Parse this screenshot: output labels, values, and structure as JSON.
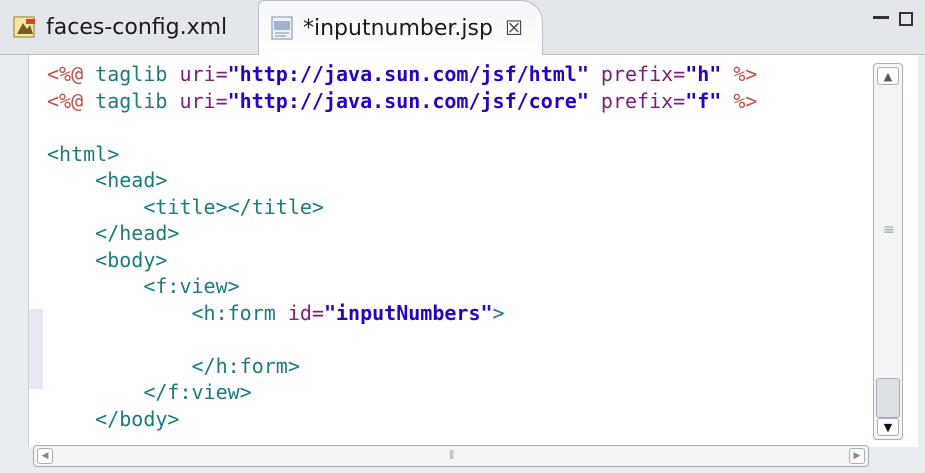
{
  "tabs": [
    {
      "label": "faces-config.xml",
      "icon": "xml-file-icon",
      "active": false
    },
    {
      "label": "*inputnumber.jsp",
      "icon": "jsp-file-icon",
      "active": true,
      "close": "☒"
    }
  ],
  "window_controls": {
    "minimize": "minimize-icon",
    "maximize": "maximize-icon"
  },
  "code_lines": [
    [
      {
        "t": "<%@",
        "c": "pct"
      },
      {
        "t": " taglib ",
        "c": "tagn"
      },
      {
        "t": "uri=",
        "c": "attr"
      },
      {
        "t": "\"http://java.sun.com/jsf/html\"",
        "c": "str"
      },
      {
        "t": " ",
        "c": "plain"
      },
      {
        "t": "prefix=",
        "c": "attr"
      },
      {
        "t": "\"h\"",
        "c": "str"
      },
      {
        "t": " %>",
        "c": "pct"
      }
    ],
    [
      {
        "t": "<%@",
        "c": "pct"
      },
      {
        "t": " taglib ",
        "c": "tagn"
      },
      {
        "t": "uri=",
        "c": "attr"
      },
      {
        "t": "\"http://java.sun.com/jsf/core\"",
        "c": "str"
      },
      {
        "t": " ",
        "c": "plain"
      },
      {
        "t": "prefix=",
        "c": "attr"
      },
      {
        "t": "\"f\"",
        "c": "str"
      },
      {
        "t": " %>",
        "c": "pct"
      }
    ],
    [],
    [
      {
        "t": "<html>",
        "c": "tagn"
      }
    ],
    [
      {
        "t": "    <head>",
        "c": "tagn"
      }
    ],
    [
      {
        "t": "        <title></title>",
        "c": "tagn"
      }
    ],
    [
      {
        "t": "    </head>",
        "c": "tagn"
      }
    ],
    [
      {
        "t": "    <body>",
        "c": "tagn"
      }
    ],
    [
      {
        "t": "        <f:view>",
        "c": "tagn"
      }
    ],
    [
      {
        "t": "            <h:form ",
        "c": "tagn"
      },
      {
        "t": "id=",
        "c": "attr"
      },
      {
        "t": "\"inputNumbers\"",
        "c": "str"
      },
      {
        "t": ">",
        "c": "tagn"
      }
    ],
    [],
    [
      {
        "t": "            </h:form>",
        "c": "tagn"
      }
    ],
    [
      {
        "t": "        </f:view>",
        "c": "tagn"
      }
    ],
    [
      {
        "t": "    </body>",
        "c": "tagn"
      }
    ]
  ],
  "scrollbars": {
    "vertical": {
      "up": "▲",
      "down": "▼",
      "grip": "≡"
    },
    "horizontal": {
      "left": "◀",
      "right": "▶",
      "grip": "⦀"
    }
  }
}
